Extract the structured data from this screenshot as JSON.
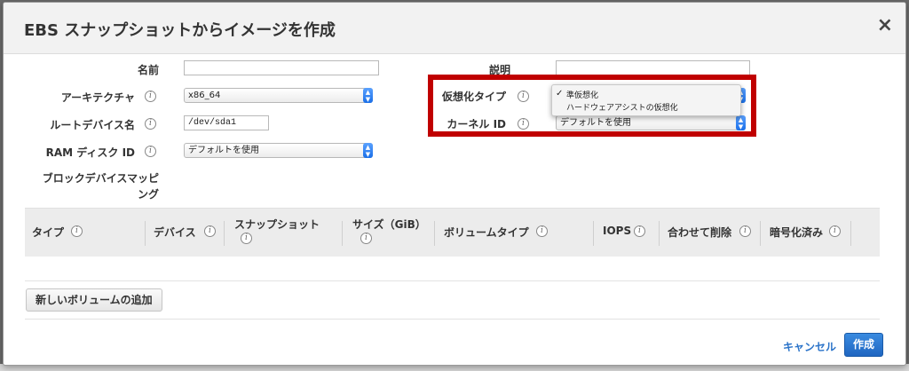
{
  "dialog": {
    "title": "EBS スナップショットからイメージを作成",
    "close_label": "×"
  },
  "form": {
    "name_label": "名前",
    "name_value": "",
    "arch_label": "アーキテクチャ",
    "arch_value": "x86_64",
    "root_device_label": "ルートデバイス名",
    "root_device_value": "/dev/sda1",
    "ramdisk_label": "RAM ディスク ID",
    "ramdisk_value": "デフォルトを使用",
    "block_device_label_line1": "ブロックデバイスマッピ",
    "block_device_label_line2": "ング",
    "description_label": "説明",
    "description_value": "",
    "virt_type_label": "仮想化タイプ",
    "kernel_label": "カーネル ID",
    "kernel_value": "デフォルトを使用",
    "info_glyph": "i"
  },
  "virt_dropdown": {
    "options": [
      "準仮想化",
      "ハードウェアアシストの仮想化"
    ],
    "selected_index": 0,
    "check_glyph": "✓"
  },
  "table": {
    "columns": [
      "タイプ",
      "デバイス",
      "スナップショット",
      "サイズ（GiB）",
      "ボリュームタイプ",
      "IOPS",
      "合わせて削除",
      "暗号化済み"
    ]
  },
  "add_volume_label": "新しいボリュームの追加",
  "footer": {
    "cancel_label": "キャンセル",
    "create_label": "作成"
  },
  "colors": {
    "highlight": "#c00000",
    "accent": "#1f66c1",
    "link": "#2a73c9"
  }
}
